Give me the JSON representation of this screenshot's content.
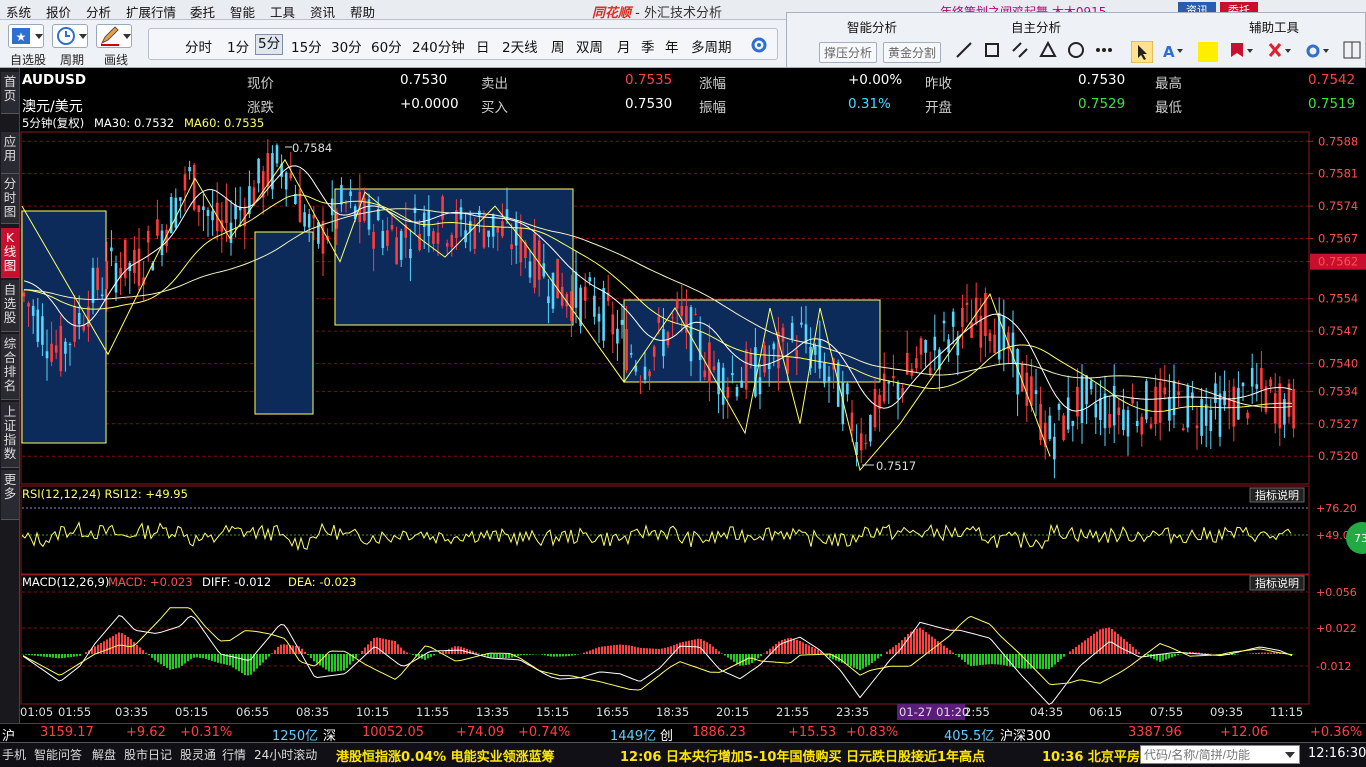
{
  "menu": [
    "系统",
    "报价",
    "分析",
    "扩展行情",
    "委托",
    "智能",
    "工具",
    "资讯",
    "帮助"
  ],
  "window_title": {
    "logo": "同花顺",
    "text": " - 外汇技术分析"
  },
  "ad_text": "年终策划之闻鸡起舞  木木0915",
  "top_buttons": [
    "资讯",
    "委托"
  ],
  "toolbar": {
    "labels": [
      "自选股",
      "周期",
      "画线"
    ]
  },
  "periods": [
    "分时",
    "1分",
    "5分",
    "15分",
    "30分",
    "60分",
    "240分钟",
    "日",
    "2天线",
    "周",
    "双周",
    "月",
    "季",
    "年",
    "多周期"
  ],
  "selected_period": "5分",
  "right_panel": {
    "headers": [
      "智能分析",
      "自主分析",
      "辅助工具"
    ],
    "btn_support": "撑压分析",
    "btn_golden": "黄金分割"
  },
  "sidebar": [
    "首页",
    "应用",
    "分时图",
    "K线图",
    "自选股",
    "综合排名",
    "上证指数",
    "更多"
  ],
  "quote": {
    "symbol": "AUDUSD",
    "name": "澳元/美元",
    "rows": [
      [
        {
          "label": "现价",
          "value": "0.7530",
          "color": "#ffffff"
        },
        {
          "label": "卖出",
          "value": "0.7535",
          "color": "#ff4040"
        },
        {
          "label": "涨幅",
          "value": "+0.00%",
          "color": "#ffffff"
        },
        {
          "label": "昨收",
          "value": "0.7530",
          "color": "#ffffff"
        },
        {
          "label": "最高",
          "value": "0.7542",
          "color": "#ff4040"
        }
      ],
      [
        {
          "label": "涨跌",
          "value": "+0.0000",
          "color": "#ffffff"
        },
        {
          "label": "买入",
          "value": "0.7530",
          "color": "#ffffff"
        },
        {
          "label": "振幅",
          "value": "0.31%",
          "color": "#3fdcff"
        },
        {
          "label": "开盘",
          "value": "0.7529",
          "color": "#3fe03f"
        },
        {
          "label": "最低",
          "value": "0.7519",
          "color": "#3fe03f"
        }
      ]
    ]
  },
  "kline": {
    "legend_period": "5分钟(复权)",
    "ma30": "MA30: 0.7532",
    "ma60": "MA60: 0.7535",
    "yticks": [
      "0.7588",
      "0.7581",
      "0.7574",
      "0.7567",
      "0.7562",
      "0.7554",
      "0.7547",
      "0.7540",
      "0.7534",
      "0.7527",
      "0.7520"
    ],
    "high_label": "0.7584",
    "low_label": "0.7517"
  },
  "rsi": {
    "label": "RSI(12,12,24) RSI12: +49.95",
    "yticks": [
      "+76.20",
      "+49.05"
    ],
    "desc_btn": "指标说明",
    "badge": "73"
  },
  "macd": {
    "label": "MACD(12,26,9)",
    "macd": "MACD: +0.023",
    "diff": "DIFF: -0.012",
    "dea": "DEA: -0.023",
    "yticks": [
      "+0.056",
      "+0.022",
      "-0.012"
    ],
    "desc_btn": "指标说明"
  },
  "time_axis": [
    "01:05",
    "01:55",
    "03:35",
    "05:15",
    "06:55",
    "08:35",
    "10:15",
    "11:55",
    "13:35",
    "15:15",
    "16:55",
    "18:35",
    "20:15",
    "21:55",
    "23:35",
    "01-27 01:20",
    "2:55",
    "04:35",
    "06:15",
    "07:55",
    "09:35",
    "11:15"
  ],
  "bottom_stats": {
    "sh": {
      "label": "沪",
      "value": "3159.17",
      "chg": "+9.62",
      "pct": "+0.31%",
      "vol": "1250亿"
    },
    "sz": {
      "label": "深",
      "value": "10052.05",
      "chg": "+74.09",
      "pct": "+0.74%",
      "vol": "1449亿"
    },
    "cy": {
      "label": "创",
      "value": "1886.23",
      "chg": "+15.53",
      "pct": "+0.83%",
      "vol": "405.5亿"
    },
    "hs300": {
      "label": "沪深300",
      "value": "3387.96",
      "chg": "+12.06",
      "pct": "+0.36%"
    }
  },
  "status": {
    "items": [
      "手机",
      "智能问答",
      "解盘",
      "股市日记",
      "股灵通",
      "行情",
      "24小时滚动"
    ],
    "tickers": [
      "港股恒指涨0.04% 电能实业领涨蓝筹",
      "12:06 日本央行增加5-10年国债购买 日元跌日股接近1年高点",
      "10:36 北京平房"
    ],
    "search_placeholder": "代码/名称/简拼/功能",
    "clock": "12:16:30"
  },
  "colors": {
    "up": "#ff3b3b",
    "down": "#54d6ff",
    "ma_yellow": "#ffff66",
    "box_fill": "#0c2a5a",
    "grid": "#7a1010"
  }
}
